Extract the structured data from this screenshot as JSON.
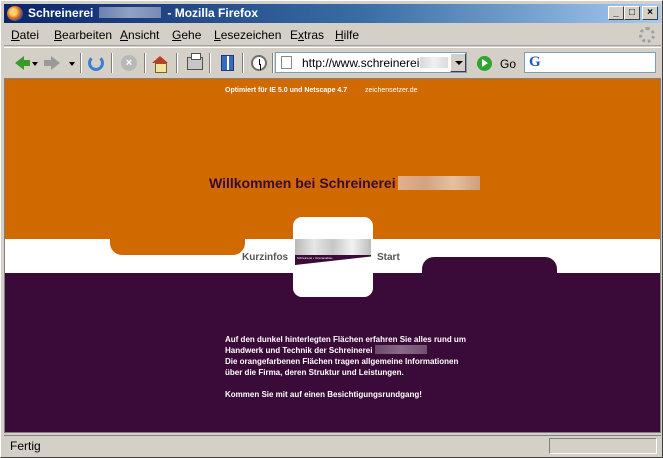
{
  "window": {
    "title_prefix": "Schreinerei",
    "title_suffix": "- Mozilla Firefox"
  },
  "menu": {
    "items": [
      {
        "underline": "D",
        "rest": "atei"
      },
      {
        "underline": "B",
        "rest": "earbeiten"
      },
      {
        "underline": "A",
        "rest": "nsicht"
      },
      {
        "underline": "G",
        "rest": "ehe"
      },
      {
        "underline": "L",
        "rest": "esezeichen"
      },
      {
        "pre": "E",
        "underline": "x",
        "rest": "tras"
      },
      {
        "underline": "H",
        "rest": "ilfe"
      }
    ]
  },
  "toolbar": {
    "url": "http://www.schreinerei-",
    "go_label": "Go"
  },
  "page": {
    "top_note_1": "Optimiert für IE 5.0 und Netscape 4.7",
    "top_note_2": "zeichensetzer.de",
    "welcome": "Willkommen bei Schreinerei",
    "nav_left": "Kurzinfos",
    "nav_right": "Start",
    "logo_tagline": "Schreinerei • Innenausbau",
    "paragraph": [
      "Auf den dunkel hinterlegten Flächen erfahren Sie alles rund um",
      "Handwerk und Technik der Schreinerei",
      "Die orangefarbenen Flächen tragen allgemeine Informationen",
      "über die Firma, deren Struktur und Leistungen."
    ],
    "closing": "Kommen Sie mit auf einen Besichtigungsrundgang!"
  },
  "status": {
    "text": "Fertig"
  },
  "colors": {
    "orange": "#d06a00",
    "purple": "#3a0a38",
    "white": "#ffffff"
  }
}
